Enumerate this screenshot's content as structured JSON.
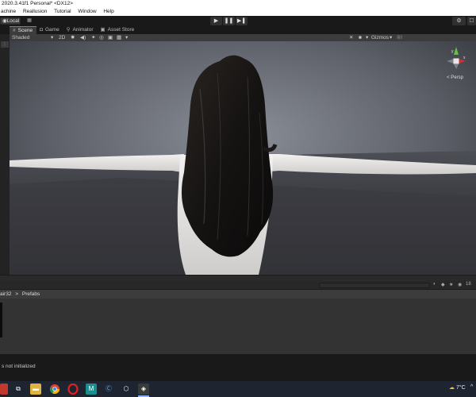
{
  "window": {
    "title": "2020.3.41f1 Personal* <DX12>"
  },
  "menu": {
    "items": [
      "achine",
      "Reallusion",
      "Tutorial",
      "Window",
      "Help"
    ]
  },
  "toolbar": {
    "local_label": "Local",
    "play_icon": "▶",
    "pause_icon": "❚❚",
    "step_icon": "▶❚",
    "collab_icon": "⚙",
    "account_icon": "☐"
  },
  "scene_tabs": [
    {
      "label": "Scene",
      "icon": "#"
    },
    {
      "label": "Game",
      "icon": "◘"
    },
    {
      "label": "Animator",
      "icon": "⚲"
    },
    {
      "label": "Asset Store",
      "icon": "▣"
    }
  ],
  "scene_toolbar": {
    "shading_mode": "Shaded",
    "shading_arrow": "▾",
    "mode_2d": "2D",
    "gizmos_label": "Gizmos",
    "search_placeholder": "All"
  },
  "viewport": {
    "projection_label": "< Persp",
    "gizmo_y": "y",
    "gizmo_x": "x"
  },
  "project": {
    "breadcrumb_parent": "air32",
    "breadcrumb_sep": ">",
    "breadcrumb_current": "Prefabs",
    "count_label": "18"
  },
  "status": {
    "message": "s not initialized"
  },
  "taskbar": {
    "weather": "7°C",
    "tray_more": "^"
  },
  "colors": {
    "accent_blue": "#4a8ad6",
    "editor_dark": "#191919",
    "panel": "#3c3c3c",
    "gizmo_red": "#d03030",
    "gizmo_green": "#6ac040"
  }
}
